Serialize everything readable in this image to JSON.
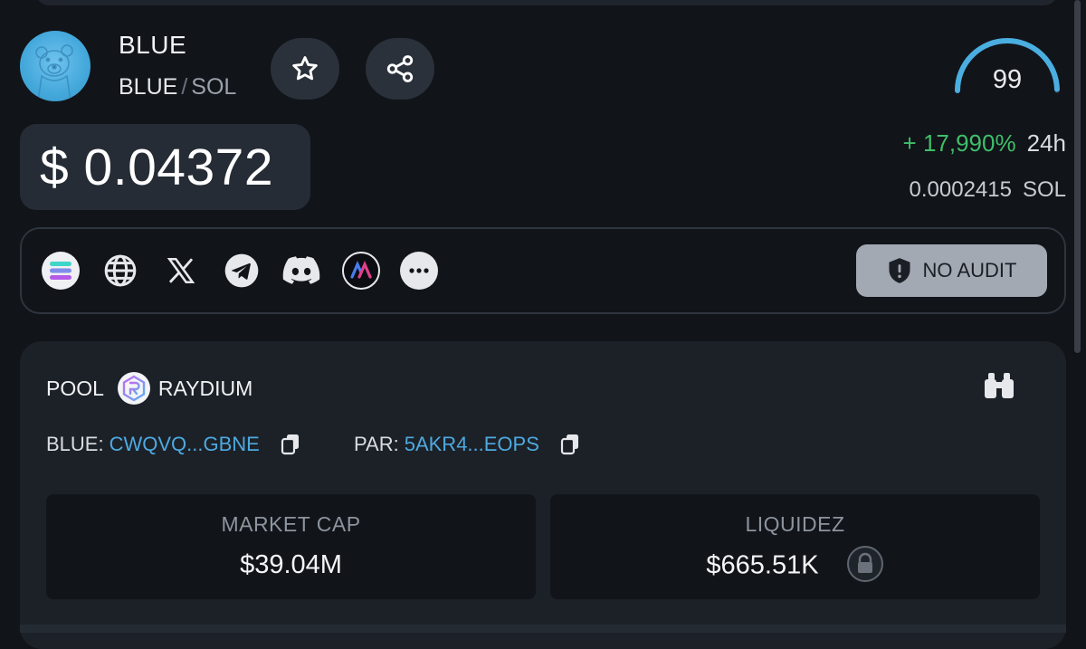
{
  "token": {
    "name": "BLUE",
    "base": "BLUE",
    "separator": "/",
    "quote": "SOL",
    "price": "$ 0.04372",
    "change_pct": "+ 17,990%",
    "change_period": "24h",
    "price_in_sol": "0.0002415",
    "price_in_sol_unit": "SOL",
    "score": "99",
    "score_fraction": 0.99
  },
  "colors": {
    "background": "#111419",
    "accent_blue": "#4ea9e0",
    "positive_green": "#3fbf6a",
    "audit_badge": "#a3a9b3"
  },
  "actions": {
    "favorite_icon": "star-icon",
    "share_icon": "share-icon"
  },
  "links": [
    {
      "icon": "solana-icon"
    },
    {
      "icon": "globe-icon"
    },
    {
      "icon": "x-icon"
    },
    {
      "icon": "telegram-icon"
    },
    {
      "icon": "discord-icon"
    },
    {
      "icon": "app-logo-icon"
    },
    {
      "icon": "more-icon"
    }
  ],
  "audit": {
    "label": "NO AUDIT",
    "icon": "shield-alert-icon"
  },
  "pool": {
    "label": "POOL",
    "dex": "RAYDIUM",
    "base_label": "BLUE:",
    "base_address": "CWQVQ...GBNE",
    "pair_label": "PAR:",
    "pair_address": "5AKR4...EOPS"
  },
  "stats": {
    "market_cap_label": "MARKET CAP",
    "market_cap_value": "$39.04M",
    "liquidity_label": "LIQUIDEZ",
    "liquidity_value": "$665.51K"
  }
}
